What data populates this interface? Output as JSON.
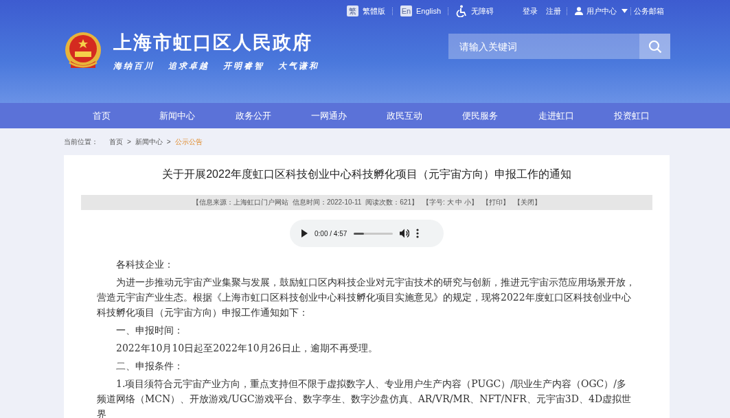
{
  "top_links": [
    {
      "kind": "traditional",
      "label": "繁體版",
      "badge": "繁"
    },
    {
      "kind": "english",
      "label": "English",
      "badge": "En"
    },
    {
      "kind": "accessible",
      "label": "无障碍"
    }
  ],
  "account_links": [
    "登录",
    "注册"
  ],
  "user_menu": {
    "label": "用户中心"
  },
  "mail_link": "公务邮箱",
  "site": {
    "title": "上海市虹口区人民政府",
    "slogans": [
      "海纳百川",
      "追求卓越",
      "开明睿智",
      "大气谦和"
    ]
  },
  "search": {
    "placeholder": "请输入关键词"
  },
  "nav": [
    {
      "label": "首页",
      "selected": false
    },
    {
      "label": "新闻中心",
      "selected": false
    },
    {
      "label": "政务公开",
      "selected": false
    },
    {
      "label": "一网通办",
      "selected": false
    },
    {
      "label": "政民互动",
      "selected": false
    },
    {
      "label": "便民服务",
      "selected": false
    },
    {
      "label": "走进虹口",
      "selected": false
    },
    {
      "label": "投资虹口",
      "selected": false
    }
  ],
  "breadcrumb": {
    "label": "当前位置：",
    "items": [
      {
        "label": "首页",
        "current": false
      },
      {
        "label": "新闻中心",
        "current": false
      },
      {
        "label": "公示公告",
        "current": true
      }
    ],
    "separator": ">"
  },
  "article": {
    "title": "关于开展2022年度虹口区科技创业中心科技孵化项目（元宇宙方向）申报工作的通知",
    "meta": [
      "【信息来源：上海虹口门户网站",
      "信息时间：2022-10-11",
      "阅读次数：621】",
      "【字号: 大 中 小】",
      "【打印】",
      "【关闭】"
    ],
    "audio": {
      "time": "0:00 / 4:57"
    },
    "paragraphs": [
      {
        "kind": "indent",
        "text": "各科技企业："
      },
      {
        "kind": "indent",
        "text": "为进一步推动元宇宙产业集聚与发展，鼓励虹口区内科技企业对元宇宙技术的研究与创新，推进元宇宙示范应用场景开放，营造元宇宙产业生态。根据《上海市虹口区科技创业中心科技孵化项目实施意见》的规定，现将2022年度虹口区科技创业中心科技孵化项目（元宇宙方向）申报工作通知如下："
      },
      {
        "kind": "indent",
        "text": "一、申报时间："
      },
      {
        "kind": "indent",
        "text": "2022年10月10日起至2022年10月26日止，逾期不再受理。"
      },
      {
        "kind": "indent",
        "text": "二、申报条件："
      },
      {
        "kind": "indent",
        "text": "1.项目须符合元宇宙产业方向，重点支持但不限于虚拟数字人、专业用户生产内容（PUGC）/职业生产内容（OGC）/多频道网络（MCN）、开放游戏/UGC游戏平台、数字孪生、数字沙盘仿真、AR/VR/MR、NFT/NFR、元宇宙3D、4D虚拟世界"
      }
    ]
  }
}
